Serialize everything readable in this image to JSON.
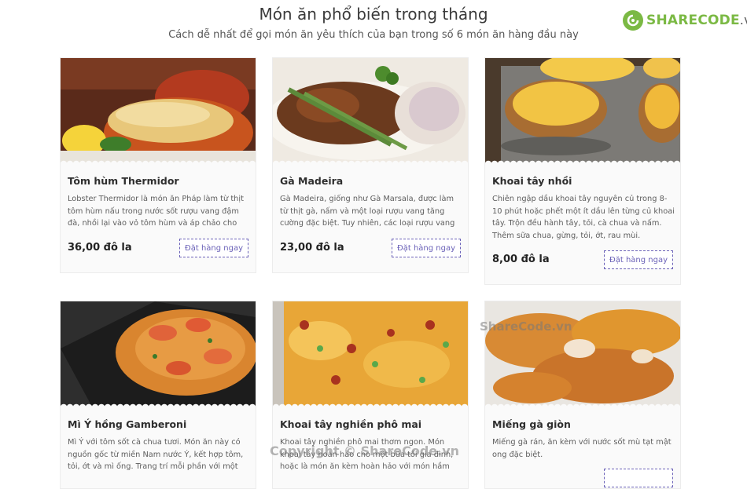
{
  "header": {
    "title": "Món ăn phổ biến trong tháng",
    "subtitle": "Cách dễ nhất để gọi món ăn yêu thích của bạn trong số 6 món ăn hàng đầu này"
  },
  "logo": {
    "brand": "SHARECODE",
    "tld": ".vn"
  },
  "order_label": "Đặt hàng ngay",
  "dishes": [
    {
      "name": "Tôm hùm Thermidor",
      "description": "Lobster Thermidor là món ăn Pháp làm từ thịt tôm hùm nấu trong nước sốt rượu vang đậm đà, nhồi lại vào vỏ tôm hùm và áp chảo cho đến khi vàng.",
      "price": "36,00 đô la",
      "image": "lobster-thermidor-photo"
    },
    {
      "name": "Gà Madeira",
      "description": "Gà Madeira, giống như Gà Marsala, được làm từ thịt gà, nấm và một loại rượu vang tăng cường đặc biệt. Tuy nhiên, các loại rượu vang thì khác nhau;",
      "price": "23,00 đô la",
      "image": "chicken-madeira-photo"
    },
    {
      "name": "Khoai tây nhồi",
      "description": "Chiên ngập dầu khoai tây nguyên củ trong 8-10 phút hoặc phết một ít dầu lên từng củ khoai tây. Trộn đều hành tây, tỏi, cà chua và nấm. Thêm sữa chua, gừng, tỏi, ớt, rau mùi.",
      "price": "8,00 đô la",
      "image": "stuffed-potato-photo"
    },
    {
      "name": "Mì Ý hồng Gamberoni",
      "description": "Mì Ý với tôm sốt cà chua tươi. Món ăn này có nguồn gốc từ miền Nam nước Ý, kết hợp tôm, tỏi, ớt và mì ống. Trang trí mỗi phần với một thìa canh",
      "price": "",
      "image": "gamberoni-pasta-photo"
    },
    {
      "name": "Khoai tây nghiền phô mai",
      "description": "Khoai tây nghiền phô mai thơm ngon. Món khoai tây hoàn hảo cho một bữa tối gia đình, hoặc là món ăn kèm hoàn hảo với món hầm xúc",
      "price": "",
      "image": "cheesy-mashed-potato-photo"
    },
    {
      "name": "Miếng gà giòn",
      "description": "Miếng gà rán, ăn kèm với nước sốt mù tạt mật ong đặc biệt.",
      "price": "",
      "image": "crispy-chicken-photo"
    }
  ],
  "watermarks": [
    "ShareCode.vn",
    "Copyright © ShareCode.vn"
  ],
  "colors": {
    "accent": "#6b62b8",
    "brand": "#7bb944"
  }
}
